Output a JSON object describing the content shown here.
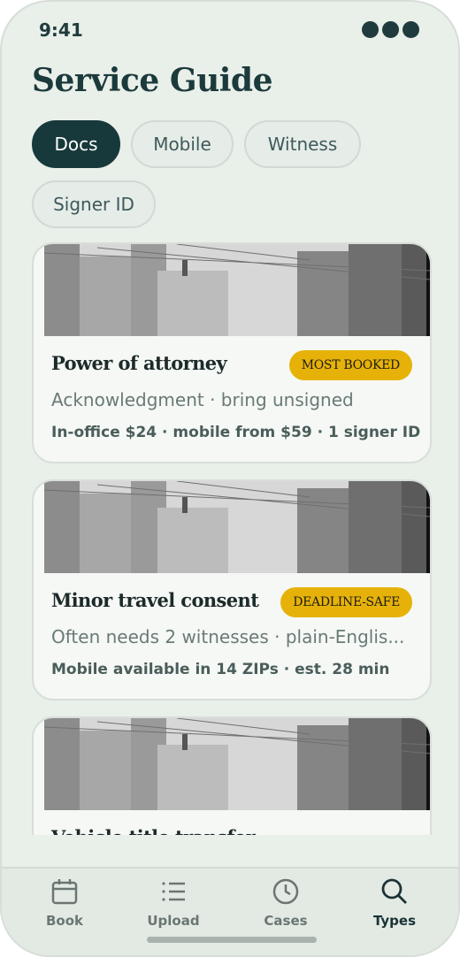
{
  "status_bar": {
    "time": "9:41"
  },
  "header": {
    "title": "Service Guide"
  },
  "filters": [
    {
      "label": "Docs",
      "active": true
    },
    {
      "label": "Mobile",
      "active": false
    },
    {
      "label": "Witness",
      "active": false
    },
    {
      "label": "Signer ID",
      "active": false
    }
  ],
  "cards": [
    {
      "title": "Power of attorney",
      "badge": "MOST BOOKED",
      "subtitle": "Acknowledgment · bring unsigned",
      "meta": "In-office $24 · mobile from $59 · 1 signer ID"
    },
    {
      "title": "Minor travel consent",
      "badge": "DEADLINE-SAFE",
      "subtitle": "Often needs 2 witnesses · plain-Englis...",
      "meta": "Mobile available in 14 ZIPs · est. 28 min"
    },
    {
      "title": "Vehicle title transfer",
      "badge": "",
      "subtitle": "",
      "meta": ""
    }
  ],
  "tabs": [
    {
      "label": "Book",
      "icon": "calendar-icon",
      "active": false
    },
    {
      "label": "Upload",
      "icon": "list-icon",
      "active": false
    },
    {
      "label": "Cases",
      "icon": "clock-icon",
      "active": false
    },
    {
      "label": "Types",
      "icon": "search-icon",
      "active": true
    }
  ],
  "colors": {
    "background": "#e9efe9",
    "primary": "#18393b",
    "badge": "#e6b20a",
    "card": "#f5f8f4"
  }
}
